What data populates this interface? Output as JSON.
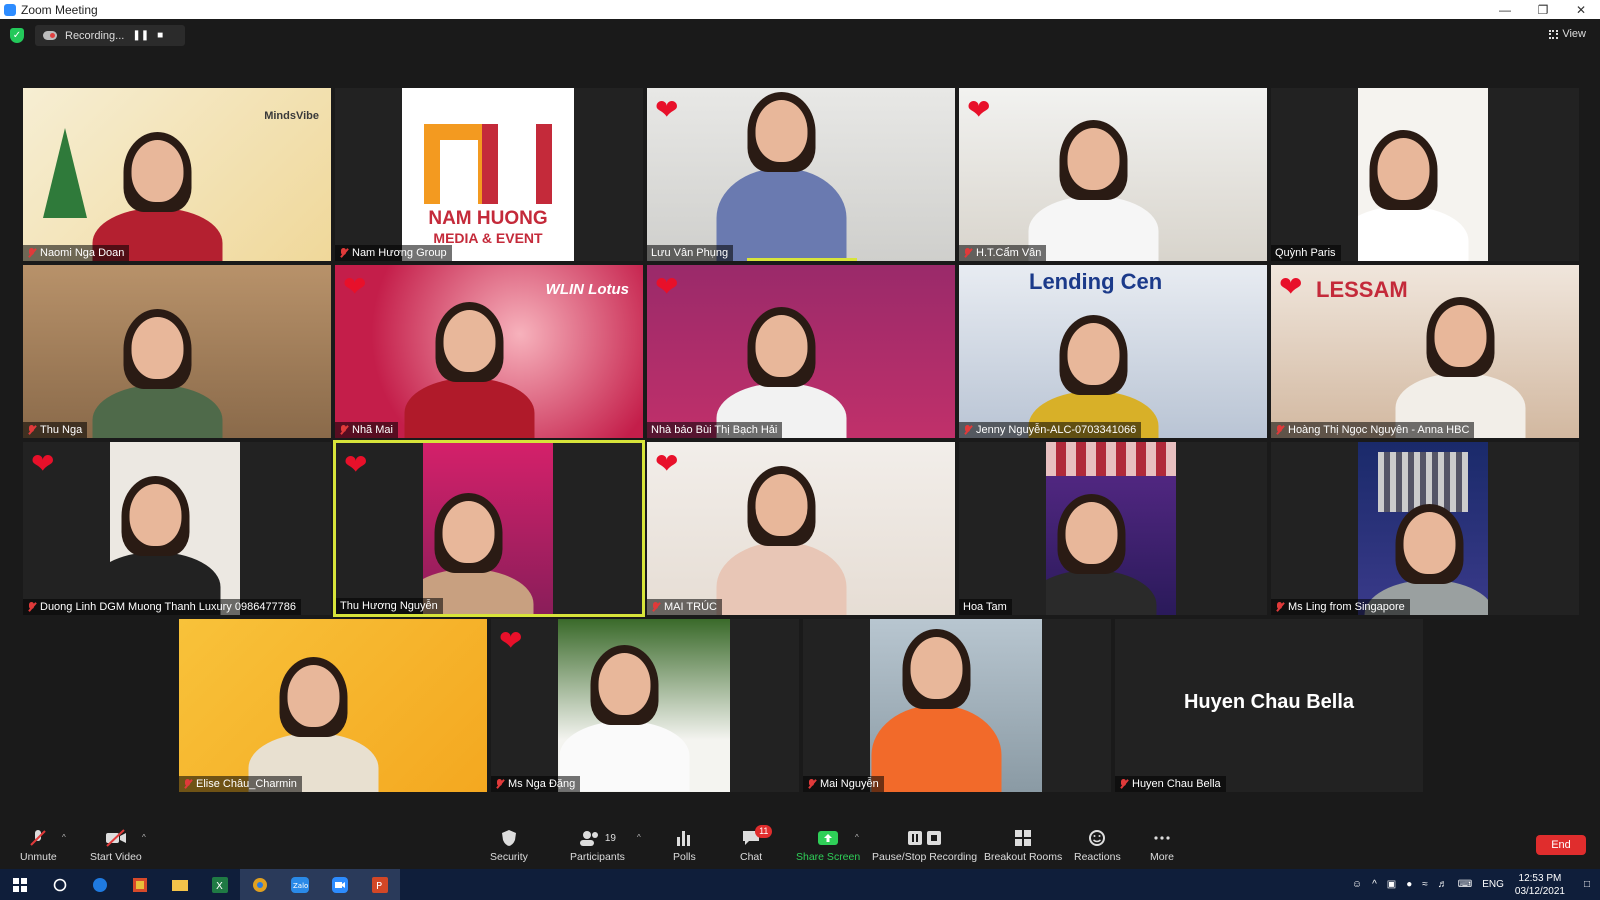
{
  "window": {
    "title": "Zoom Meeting"
  },
  "topbar": {
    "recording_label": "Recording...",
    "view_label": "View"
  },
  "participants": [
    {
      "name": "Naomi Nga Doan",
      "muted": true,
      "heart": false,
      "big_text": "",
      "logo": "MindsVibe"
    },
    {
      "name": "Nam Hương Group",
      "muted": true,
      "heart": false,
      "big_text": "",
      "logo": "NAM HUONG",
      "logo_sub": "MEDIA & EVENT"
    },
    {
      "name": "Lưu Vân Phụng",
      "muted": false,
      "heart": true,
      "big_text": ""
    },
    {
      "name": "H.T.Cẩm Vân",
      "muted": true,
      "heart": true,
      "big_text": ""
    },
    {
      "name": "Quỳnh Paris",
      "muted": false,
      "heart": false,
      "big_text": ""
    },
    {
      "name": "Thu Nga",
      "muted": true,
      "heart": false,
      "big_text": ""
    },
    {
      "name": "Nhã Mai",
      "muted": true,
      "heart": true,
      "big_text": "",
      "logo": "WLIN Lotus"
    },
    {
      "name": "Nhà báo Bùi Thị Bạch Hải",
      "muted": false,
      "heart": true,
      "big_text": ""
    },
    {
      "name": "Jenny Nguyễn-ALC-0703341066",
      "muted": true,
      "heart": false,
      "big_text": "",
      "logo": "Lending Cen"
    },
    {
      "name": "Hoàng Thị Ngọc Nguyên - Anna HBC",
      "muted": true,
      "heart": true,
      "big_text": "",
      "logo": "LESSAM"
    },
    {
      "name": "Duong Linh DGM Muong Thanh Luxury 0986477786",
      "muted": true,
      "heart": true,
      "big_text": ""
    },
    {
      "name": "Thu Hương Nguyễn",
      "muted": false,
      "heart": true,
      "big_text": "",
      "active": true
    },
    {
      "name": "MAI TRÚC",
      "muted": true,
      "heart": true,
      "big_text": ""
    },
    {
      "name": "Hoa Tam",
      "muted": false,
      "heart": false,
      "big_text": ""
    },
    {
      "name": "Ms Ling from Singapore",
      "muted": true,
      "heart": false,
      "big_text": ""
    },
    {
      "name": "Elise Châu_Charmin",
      "muted": true,
      "heart": false,
      "big_text": ""
    },
    {
      "name": "Ms Nga Đặng",
      "muted": true,
      "heart": true,
      "big_text": ""
    },
    {
      "name": "Mai Nguyễn",
      "muted": true,
      "heart": false,
      "big_text": ""
    },
    {
      "name": "Huyen Chau Bella",
      "muted": true,
      "heart": false,
      "big_text": "Huyen Chau Bella"
    }
  ],
  "toolbar": {
    "unmute": "Unmute",
    "start_video": "Start Video",
    "security": "Security",
    "participants": "Participants",
    "participants_count": "19",
    "polls": "Polls",
    "chat": "Chat",
    "chat_badge": "11",
    "share_screen": "Share Screen",
    "pause_stop_recording": "Pause/Stop Recording",
    "breakout_rooms": "Breakout Rooms",
    "reactions": "Reactions",
    "more": "More",
    "end": "End"
  },
  "taskbar": {
    "lang": "ENG",
    "time": "12:53 PM",
    "date": "03/12/2021"
  },
  "colors": {
    "accent_green": "#2fcf58",
    "end_red": "#e02d2d",
    "active_border": "#d7e43a",
    "heart": "#e8102a"
  }
}
